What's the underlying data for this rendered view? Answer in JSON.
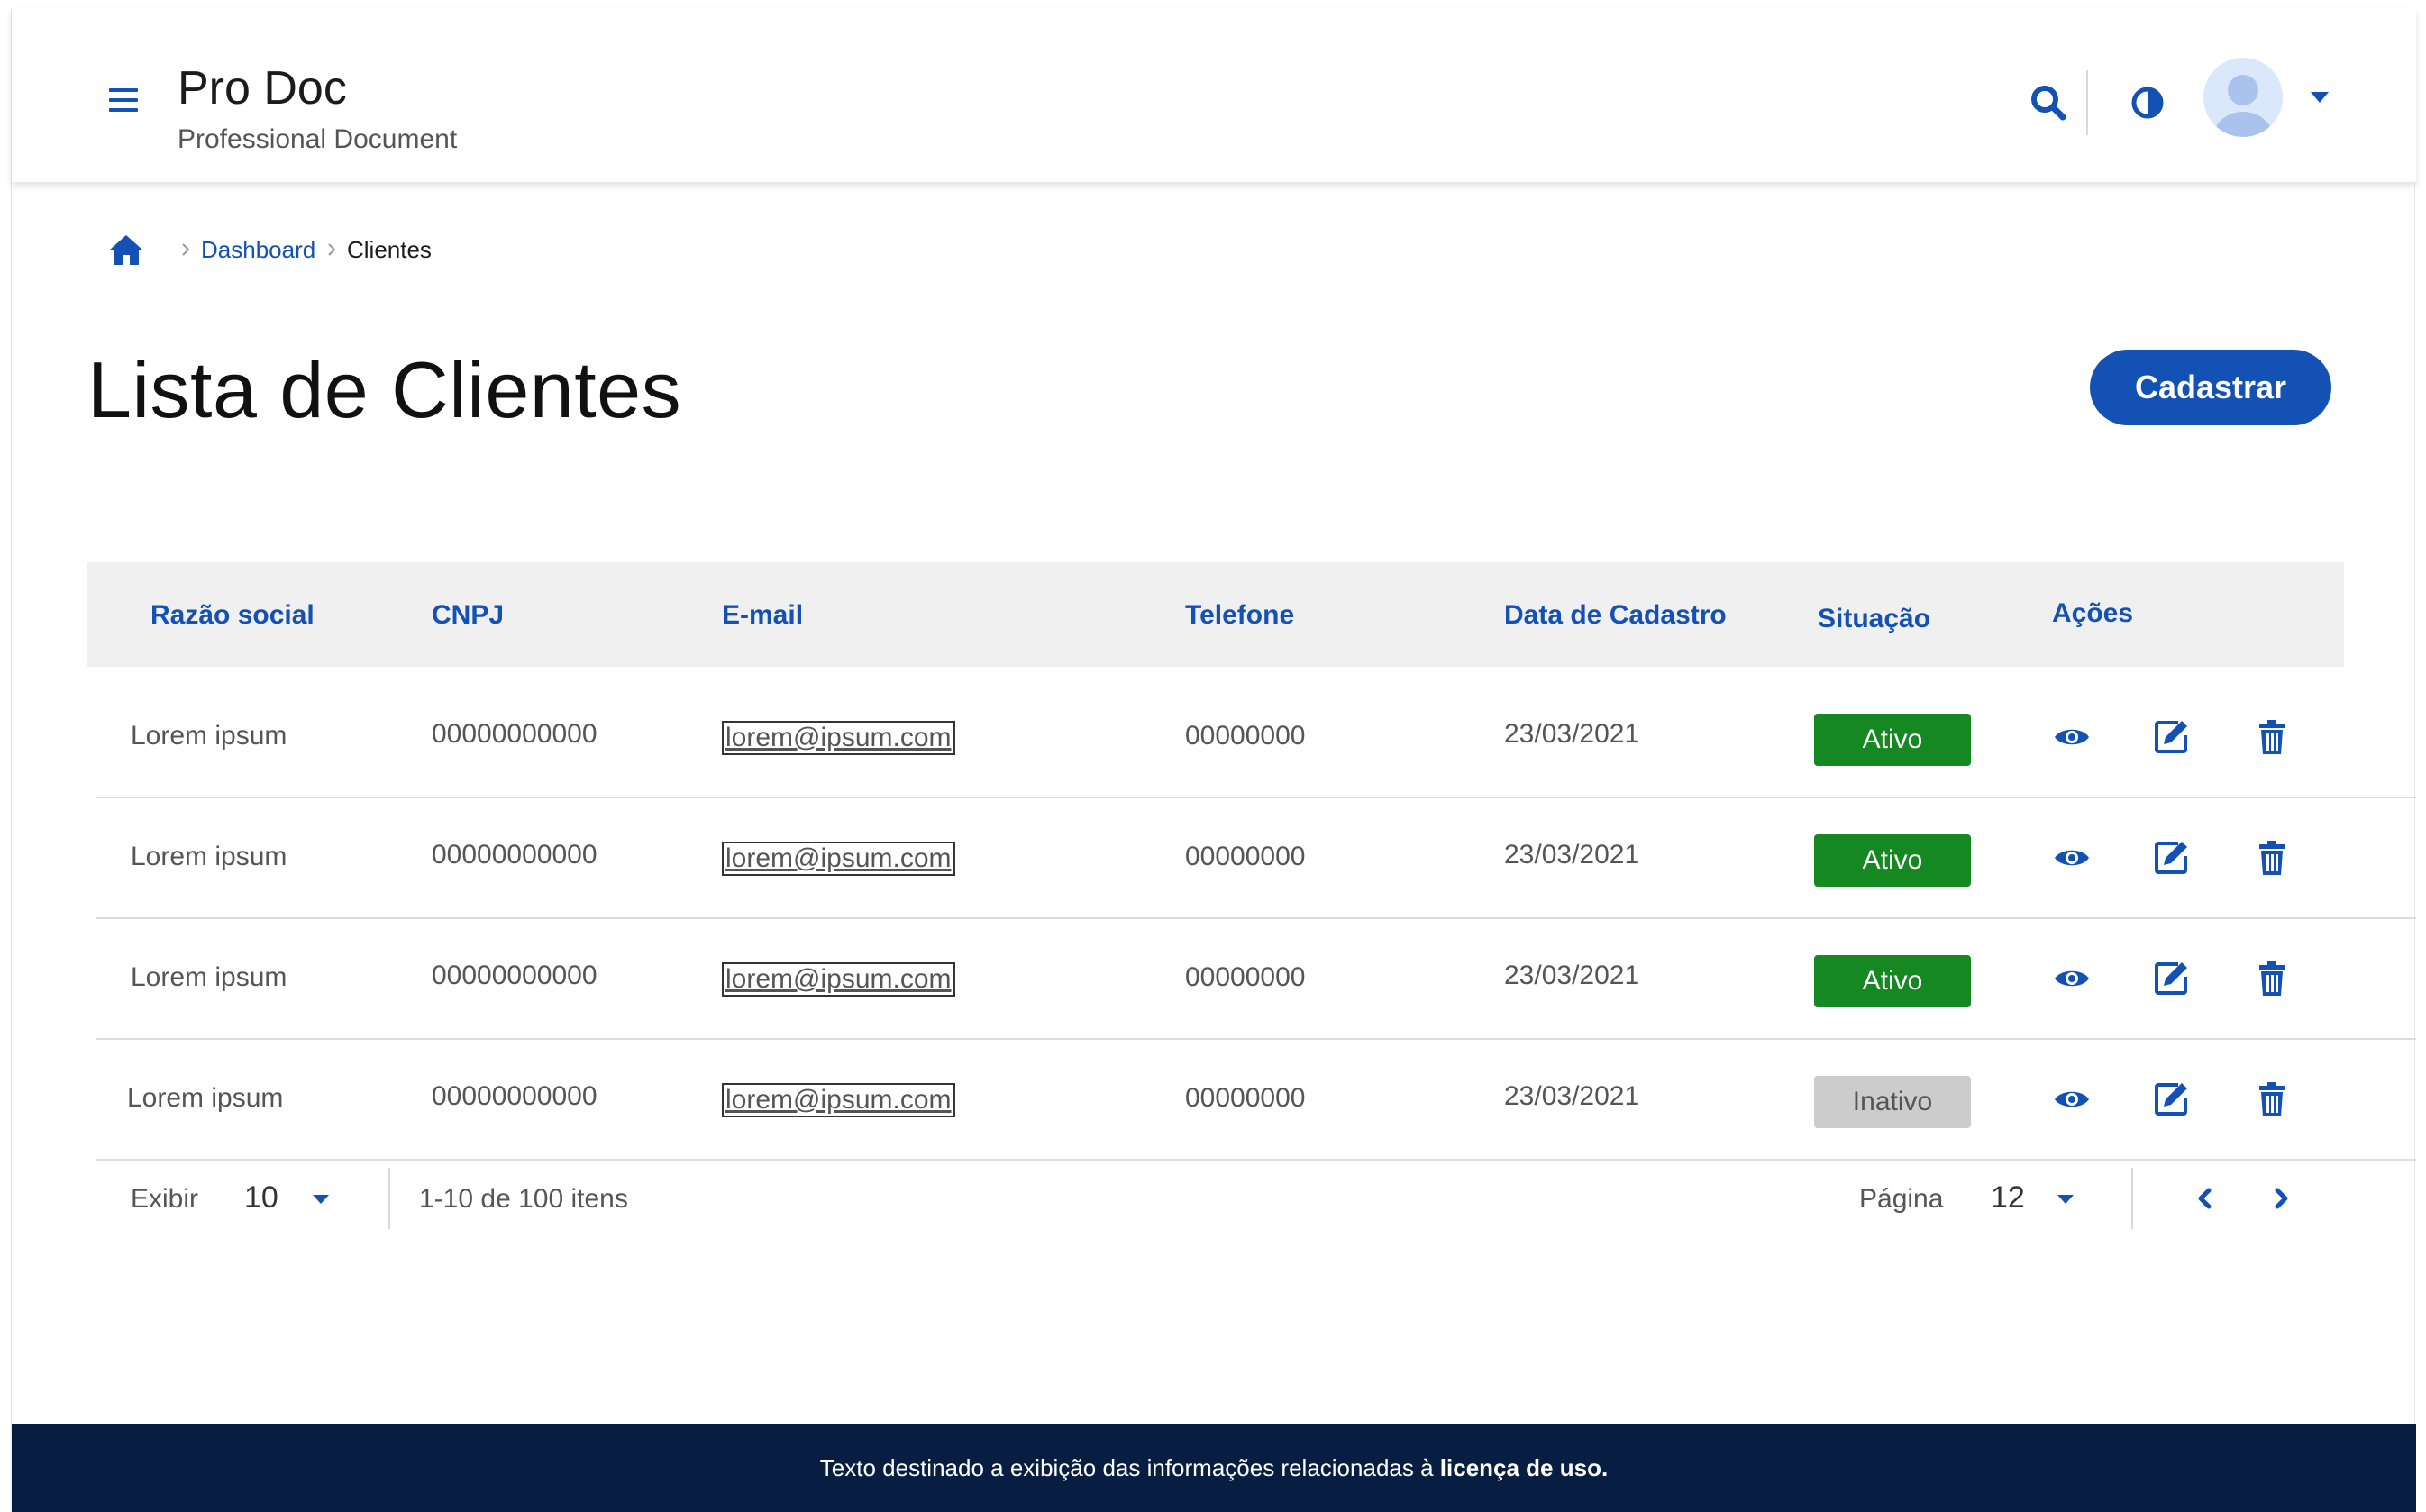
{
  "app": {
    "title": "Pro Doc",
    "subtitle": "Professional Document"
  },
  "colors": {
    "primary": "#1351b4",
    "active": "#168821",
    "inactive": "#cccccc",
    "footer": "#071d41",
    "header_bg": "#f0f0f0"
  },
  "icons": {
    "menu": "hamburger-icon",
    "search": "search-icon",
    "contrast": "contrast-icon",
    "avatar": "user-avatar-icon",
    "home": "home-icon",
    "view": "eye-icon",
    "edit": "edit-icon",
    "delete": "trash-icon"
  },
  "breadcrumb": {
    "items": [
      "Dashboard",
      "Clientes"
    ]
  },
  "page": {
    "title": "Lista de Clientes",
    "action_label": "Cadastrar"
  },
  "table": {
    "columns": [
      "Razão social",
      "CNPJ",
      "E-mail",
      "Telefone",
      "Data de Cadastro",
      "Situação",
      "Ações"
    ],
    "rows": [
      {
        "razao": "Lorem ipsum",
        "cnpj": "00000000000",
        "email": "lorem@ipsum.com",
        "telefone": "00000000",
        "data": "23/03/2021",
        "situacao": "Ativo"
      },
      {
        "razao": "Lorem ipsum",
        "cnpj": "00000000000",
        "email": "lorem@ipsum.com",
        "telefone": "00000000",
        "data": "23/03/2021",
        "situacao": "Ativo"
      },
      {
        "razao": "Lorem ipsum",
        "cnpj": "00000000000",
        "email": "lorem@ipsum.com",
        "telefone": "00000000",
        "data": "23/03/2021",
        "situacao": "Ativo"
      },
      {
        "razao": "Lorem ipsum",
        "cnpj": "00000000000",
        "email": "lorem@ipsum.com",
        "telefone": "00000000",
        "data": "23/03/2021",
        "situacao": "Inativo"
      }
    ]
  },
  "pagination": {
    "show_label": "Exibir",
    "page_size": "10",
    "range": "1-10 de 100 itens",
    "page_label": "Página",
    "current_page": "12"
  },
  "footer": {
    "text": "Texto destinado a exibição das informações relacionadas à",
    "bold": "licença de uso."
  }
}
